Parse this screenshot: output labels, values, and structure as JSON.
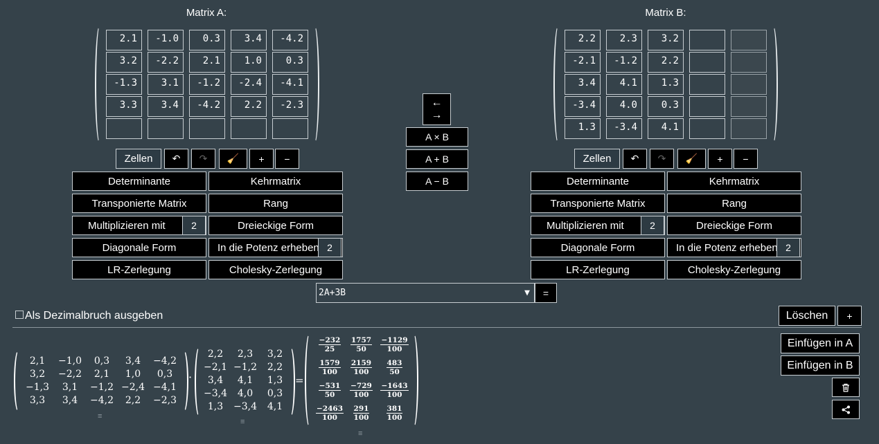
{
  "matrixA": {
    "title": "Matrix A:",
    "rows": [
      [
        "2.1",
        "-1.0",
        "0.3",
        "3.4",
        "-4.2"
      ],
      [
        "3.2",
        "-2.2",
        "2.1",
        "1.0",
        "0.3"
      ],
      [
        "-1.3",
        "3.1",
        "-1.2",
        "-2.4",
        "-4.1"
      ],
      [
        "3.3",
        "3.4",
        "-4.2",
        "2.2",
        "-2.3"
      ],
      [
        "",
        "",
        "",
        "",
        ""
      ]
    ]
  },
  "matrixB": {
    "title": "Matrix B:",
    "rows": [
      [
        "2.2",
        "2.3",
        "3.2",
        "",
        ""
      ],
      [
        "-2.1",
        "-1.2",
        "2.2",
        "",
        ""
      ],
      [
        "3.4",
        "4.1",
        "1.3",
        "",
        ""
      ],
      [
        "-3.4",
        "4.0",
        "0.3",
        "",
        ""
      ],
      [
        "1.3",
        "-3.4",
        "4.1",
        "",
        ""
      ]
    ]
  },
  "toolbar": {
    "cells": "Zellen",
    "undo": "↶",
    "redo": "↷",
    "clear": "🧹",
    "add": "+",
    "remove": "−"
  },
  "ops": {
    "determinant": "Determinante",
    "inverse": "Kehrmatrix",
    "transpose": "Transponierte Matrix",
    "rank": "Rang",
    "multiply": "Multiplizieren mit",
    "multiply_value": "2",
    "triangular": "Dreieckige Form",
    "diagonal": "Diagonale Form",
    "power": "In die Potenz erheben",
    "power_value": "2",
    "lu": "LR-Zerlegung",
    "cholesky": "Cholesky-Zerlegung"
  },
  "middle": {
    "swap_top": "←",
    "swap_bottom": "→",
    "mul": "A × B",
    "add": "A + B",
    "sub": "A − B"
  },
  "expression": {
    "value": "2A+3B",
    "arrow": "▼",
    "equals": "="
  },
  "decimal_label": "Als Dezimalbruch ausgeben",
  "side": {
    "delete": "Löschen",
    "plus": "+",
    "insertA": "Einfügen in A",
    "insertB": "Einfügen in B",
    "trash_icon": "trash-icon",
    "share_icon": "share-icon"
  },
  "result": {
    "A": [
      [
        "2,1",
        "−1,0",
        "0,3",
        "3,4",
        "−4,2"
      ],
      [
        "3,2",
        "−2,2",
        "2,1",
        "1,0",
        "0,3"
      ],
      [
        "−1,3",
        "3,1",
        "−1,2",
        "−2,4",
        "−4,1"
      ],
      [
        "3,3",
        "3,4",
        "−4,2",
        "2,2",
        "−2,3"
      ]
    ],
    "B": [
      [
        "2,2",
        "2,3",
        "3,2"
      ],
      [
        "−2,1",
        "−1,2",
        "2,2"
      ],
      [
        "3,4",
        "4,1",
        "1,3"
      ],
      [
        "−3,4",
        "4,0",
        "0,3"
      ],
      [
        "1,3",
        "−3,4",
        "4,1"
      ]
    ],
    "dot": "·",
    "equals": "=",
    "C": [
      [
        [
          "−232",
          "25"
        ],
        [
          "1757",
          "50"
        ],
        [
          "−1129",
          "100"
        ]
      ],
      [
        [
          "1579",
          "100"
        ],
        [
          "2159",
          "100"
        ],
        [
          "483",
          "50"
        ]
      ],
      [
        [
          "−531",
          "50"
        ],
        [
          "−729",
          "100"
        ],
        [
          "−1643",
          "100"
        ]
      ],
      [
        [
          "−2463",
          "100"
        ],
        [
          "291",
          "100"
        ],
        [
          "381",
          "100"
        ]
      ]
    ],
    "handle": "≡"
  }
}
